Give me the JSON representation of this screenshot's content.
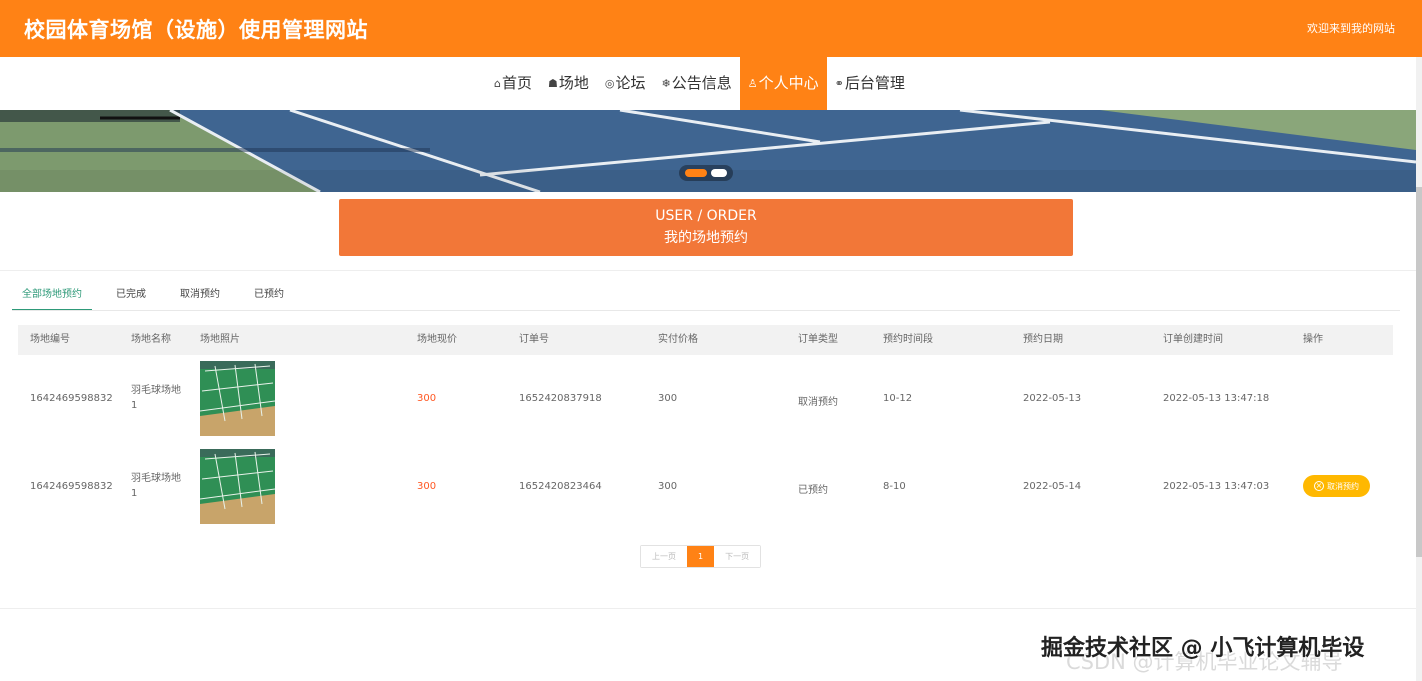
{
  "header": {
    "site_title": "校园体育场馆（设施）使用管理网站",
    "welcome": "欢迎来到我的网站"
  },
  "nav": {
    "items": [
      {
        "icon": "home-icon",
        "glyph": "⌂",
        "label": "首页"
      },
      {
        "icon": "graduation-cap-icon",
        "glyph": "☗",
        "label": "场地"
      },
      {
        "icon": "chat-bubble-icon",
        "glyph": "◎",
        "label": "论坛"
      },
      {
        "icon": "snowflake-icon",
        "glyph": "❄",
        "label": "公告信息"
      },
      {
        "icon": "user-icon",
        "glyph": "♙",
        "label": "个人中心",
        "active": true
      },
      {
        "icon": "link-icon",
        "glyph": "⚭",
        "label": "后台管理"
      }
    ]
  },
  "carousel": {
    "active_index": 0,
    "count": 2
  },
  "section": {
    "title_en": "USER / ORDER",
    "title_cn": "我的场地预约"
  },
  "tabs": [
    {
      "label": "全部场地预约",
      "active": true
    },
    {
      "label": "已完成"
    },
    {
      "label": "取消预约"
    },
    {
      "label": "已预约"
    }
  ],
  "table": {
    "headers": [
      "场地编号",
      "场地名称",
      "场地照片",
      "场地现价",
      "订单号",
      "实付价格",
      "订单类型",
      "预约时间段",
      "预约日期",
      "订单创建时间",
      "操作"
    ],
    "rows": [
      {
        "venue_id": "1642469598832",
        "venue_name": "羽毛球场地1",
        "current_price": "300",
        "order_no": "1652420837918",
        "paid_price": "300",
        "order_type": "取消预约",
        "time_slot": "10-12",
        "date": "2022-05-13",
        "created_at": "2022-05-13 13:47:18",
        "action": ""
      },
      {
        "venue_id": "1642469598832",
        "venue_name": "羽毛球场地1",
        "current_price": "300",
        "order_no": "1652420823464",
        "paid_price": "300",
        "order_type": "已预约",
        "time_slot": "8-10",
        "date": "2022-05-14",
        "created_at": "2022-05-13 13:47:03",
        "action": "取消预约"
      }
    ]
  },
  "pagination": {
    "prev": "上一页",
    "current": "1",
    "next": "下一页"
  },
  "watermark": {
    "main": "掘金技术社区 @ 小飞计算机毕设",
    "ghost": "CSDN @计算机毕业论文辅导"
  },
  "colors": {
    "brand_orange": "#ff8215",
    "section_banner": "#f27738",
    "price_red": "#ff5722",
    "tab_active_green": "#2e9a79",
    "cancel_button_yellow": "#ffb800"
  }
}
